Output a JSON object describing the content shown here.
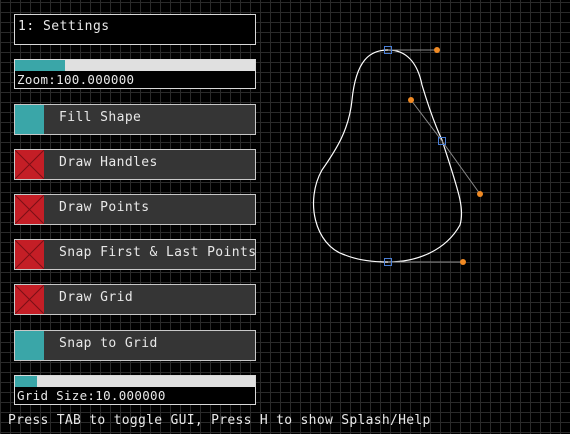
{
  "panel": {
    "title": "1: Settings",
    "zoom": {
      "label": "Zoom:100.000000",
      "fraction": 0.21
    },
    "toggles": [
      {
        "label": "Fill Shape",
        "checked": true
      },
      {
        "label": "Draw Handles",
        "checked": false
      },
      {
        "label": "Draw Points",
        "checked": false
      },
      {
        "label": "Snap First & Last Points",
        "checked": false
      },
      {
        "label": "Draw Grid",
        "checked": false
      },
      {
        "label": "Snap to Grid",
        "checked": true
      }
    ],
    "grid_size": {
      "label": "Grid Size:10.000000",
      "fraction": 0.09
    }
  },
  "footer": {
    "help_text": "Press TAB to toggle GUI, Press H to show Splash/Help"
  },
  "colors": {
    "accent": "#3aa6a8",
    "off": "#c41e26",
    "handle": "#f08a24",
    "anchor": "#4a7fd6"
  }
}
